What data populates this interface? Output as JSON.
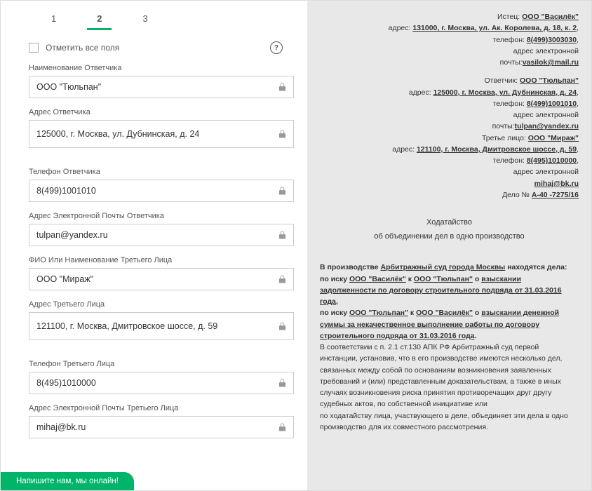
{
  "tabs": [
    "1",
    "2",
    "3"
  ],
  "active_tab": 1,
  "check_all_label": "Отметить все поля",
  "help_icon": "?",
  "form": {
    "fields": [
      {
        "label": "Наименование Ответчика",
        "value": "ООО \"Тюльпан\"",
        "locked": true,
        "gap": false,
        "tall": false
      },
      {
        "label": "Адрес Ответчика",
        "value": "125000, г. Москва, ул. Дубнинская, д. 24",
        "locked": true,
        "gap": true,
        "tall": true
      },
      {
        "label": "Телефон Ответчика",
        "value": "8(499)1001010",
        "locked": true,
        "gap": false,
        "tall": false
      },
      {
        "label": "Адрес Электронной Почты Ответчика",
        "value": "tulpan@yandex.ru",
        "locked": true,
        "gap": false,
        "tall": false
      },
      {
        "label": "ФИО Или Наименование Третьего Лица",
        "value": "ООО \"Мираж\"",
        "locked": true,
        "gap": false,
        "tall": false
      },
      {
        "label": "Адрес Третьего Лица",
        "value": "121100, г. Москва, Дмитровское шоссе, д. 59",
        "locked": true,
        "gap": true,
        "tall": true
      },
      {
        "label": "Телефон Третьего Лица",
        "value": "8(495)1010000",
        "locked": true,
        "gap": false,
        "tall": false
      },
      {
        "label": "Адрес Электронной Почты Третьего Лица",
        "value": "mihaj@bk.ru",
        "locked": true,
        "gap": false,
        "tall": false
      }
    ]
  },
  "chat_widget": "Напишите нам, мы онлайн!",
  "document": {
    "plaintiff_prefix": "Истец: ",
    "plaintiff_name": "ООО \"Василёк\"",
    "addr_prefix": "адрес: ",
    "plaintiff_addr": "131000, г. Москва, ул. Ак. Королева, д. 18, к. 2",
    "phone_prefix": "телефон: ",
    "plaintiff_phone": "8(499)3003030",
    "email_prefix": "адрес электронной",
    "email_prefix2": "почты:",
    "plaintiff_email": "vasilok@mail.ru",
    "defendant_prefix": "Ответчик: ",
    "defendant_name": "ООО \"Тюльпан\"",
    "defendant_addr": "125000, г. Москва, ул. Дубнинская, д. 24",
    "defendant_phone": "8(499)1001010",
    "defendant_email": "tulpan@yandex.ru",
    "third_prefix": "Третье лицо: ",
    "third_name": "ООО \"Мираж\"",
    "third_addr": "121100, г. Москва, Дмитровское шоссе, д. 59",
    "third_phone": "8(495)1010000",
    "third_email": "mihaj@bk.ru",
    "case_prefix": "Дело № ",
    "case_number": "А-40 -7275/16",
    "title": "Ходатайство",
    "subtitle": "об объединении дел в одно производство",
    "body_p1a": "В производстве ",
    "body_court": "Арбитражный суд города Москвы",
    "body_p1b": " находятся дела:",
    "body_p2a": "по иску ",
    "body_p2_pl": "ООО \"Василёк\"",
    "body_p2b": " к ",
    "body_p2_def": "ООО \"Тюльпан\"",
    "body_p2c": " о ",
    "body_p2_claim": "взыскании задолженности по договору строительного подряда от 31.03.2016 года",
    "body_p3a": "по иску ",
    "body_p3_pl": "ООО \"Тюльпан\"",
    "body_p3b": " к ",
    "body_p3_def": "ООО \"Василёк\"",
    "body_p3c": " о ",
    "body_p3_claim": "взыскании денежной суммы за некачественное выполнение работы по договору строительного подряда от 31.03.2016 года",
    "body_p4": "В соответствии с п. 2.1 ст.130 АПК РФ Арбитражный суд первой инстанции, установив, что в его производстве имеются несколько дел, связанных между собой по основаниям возникновения заявленных требований и (или) представленным доказательствам, а также в иных",
    "body_p5": "случаях возникновения риска принятия противоречащих друг другу судебных актов, по собственной инициативе или",
    "body_p6": "по ходатайству лица, участвующего в деле, объединяет эти дела в одно производство для их совместного рассмотрения."
  }
}
